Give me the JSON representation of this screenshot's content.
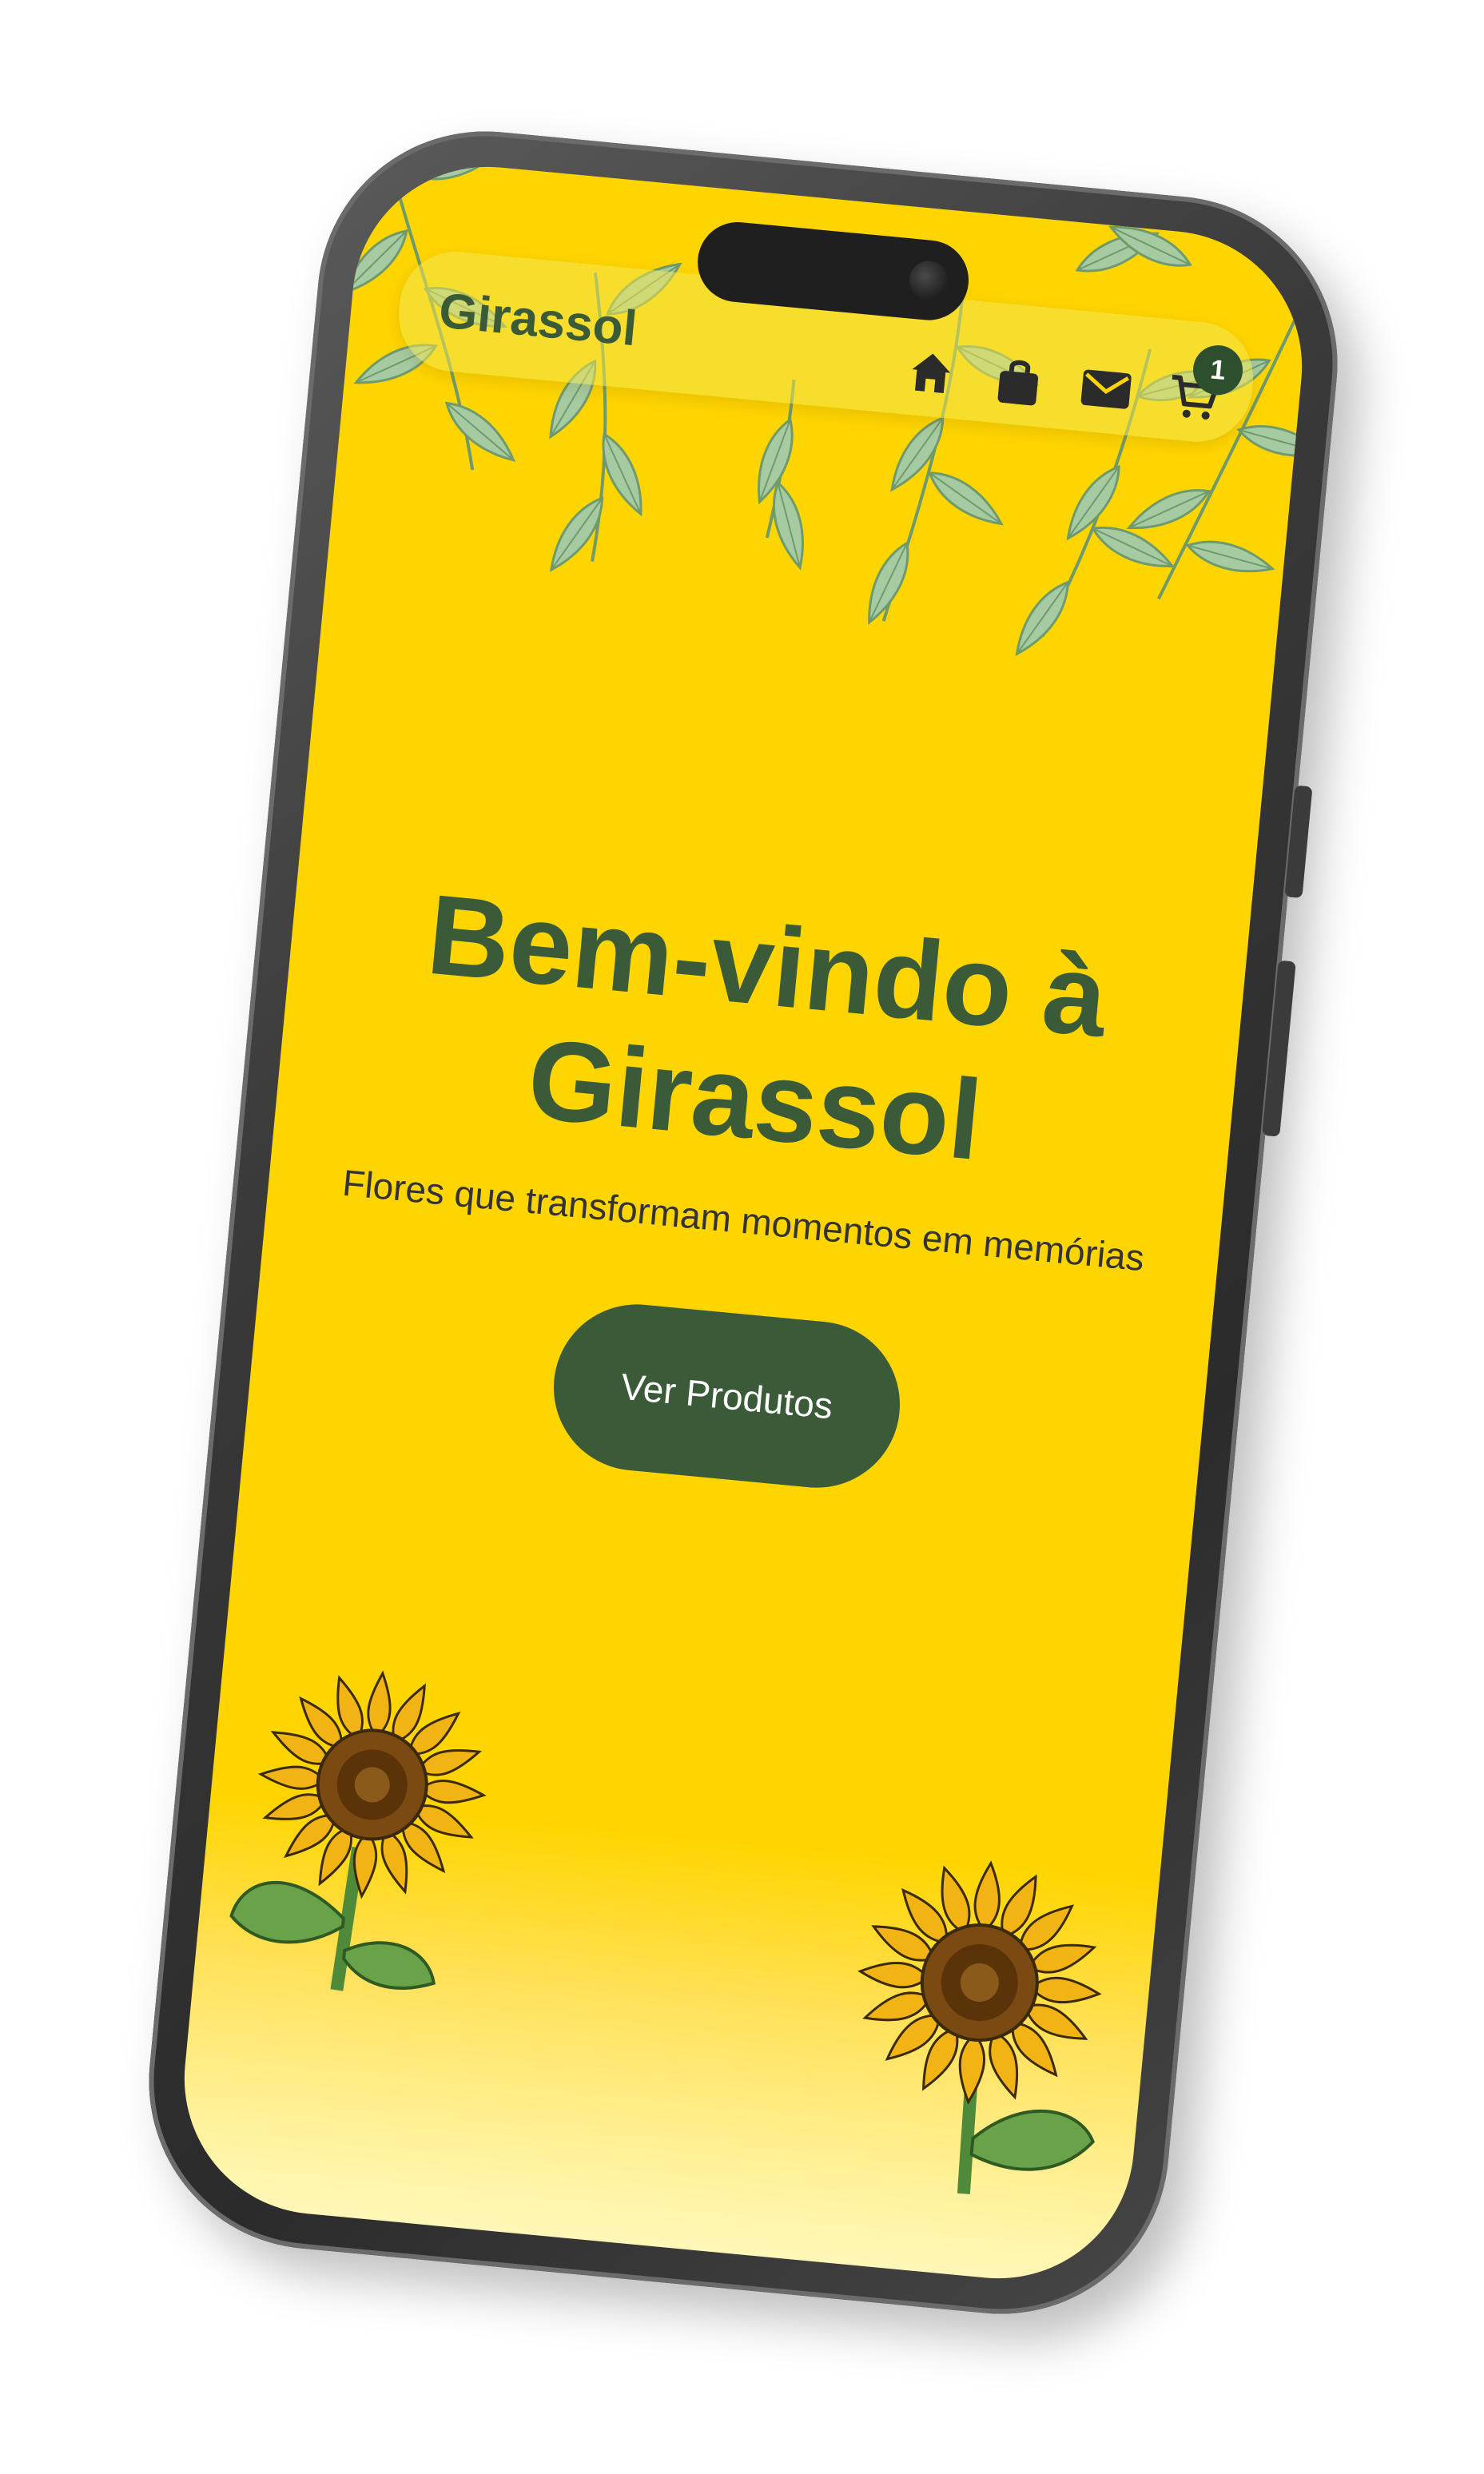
{
  "app": {
    "brand": "Girassol"
  },
  "navbar": {
    "icons": [
      {
        "name": "home-icon"
      },
      {
        "name": "shopping-bag-icon"
      },
      {
        "name": "mail-icon"
      },
      {
        "name": "cart-icon"
      }
    ],
    "cart_count": "1"
  },
  "hero": {
    "title": "Bem-vindo à Girassol",
    "subtitle": "Flores que transformam momentos em memórias",
    "cta_label": "Ver Produtos"
  },
  "colors": {
    "background_yellow": "#ffd500",
    "brand_green": "#3a5a38",
    "leaf_green": "#9bc49a",
    "phone_frame": "#3a3a3a"
  }
}
